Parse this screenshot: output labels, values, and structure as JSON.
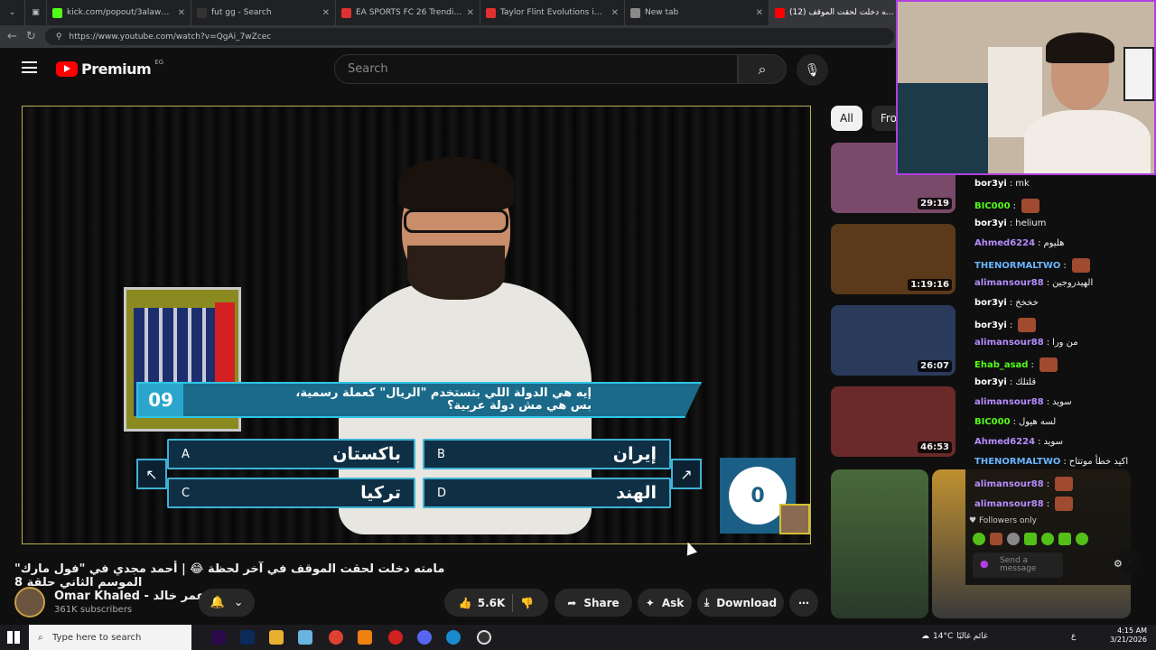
{
  "browser": {
    "tabs": [
      {
        "title": "kick.com/popout/3alawyhd/",
        "color": "#53fc18",
        "active": false
      },
      {
        "title": "fut gg - Search",
        "color": "#333333",
        "active": false
      },
      {
        "title": "EA SPORTS FC 26 Trending Evolu",
        "color": "#e03030",
        "active": false
      },
      {
        "title": "Taylor Flint Evolutions in EA FC 2",
        "color": "#e03030",
        "active": false
      },
      {
        "title": "New tab",
        "color": "#888888",
        "active": false
      },
      {
        "title": "(12) مامته دخلت لحقت الموقف",
        "color": "#ff0000",
        "active": true
      }
    ],
    "url": "https://www.youtube.com/watch?v=QgAi_7wZcec"
  },
  "header": {
    "logo_text": "Premium",
    "region": "EG",
    "search_placeholder": "Search"
  },
  "player": {
    "question_number": "09",
    "question": "إيه هي الدولة اللي بتستخدم \"الريال\" كعملة رسمية، بس هي مش دولة عربية؟",
    "answers": [
      {
        "letter": "A",
        "text": "باكستان"
      },
      {
        "letter": "B",
        "text": "إيران"
      },
      {
        "letter": "C",
        "text": "تركيا"
      },
      {
        "letter": "D",
        "text": "الهند"
      }
    ],
    "score": "0"
  },
  "video": {
    "title": "مامته دخلت لحقت الموقف في آخر لحظة 😂 | أحمد مجدي في \"فول مارك\" الموسم الثاني حلقة 8",
    "channel": "Omar Khaled - عمر خالد",
    "subscribers": "361K subscribers",
    "likes": "5.6K",
    "share_label": "Share",
    "ask_label": "Ask",
    "download_label": "Download"
  },
  "sidebar": {
    "chips": [
      "All",
      "From"
    ],
    "videos": [
      {
        "duration": "29:19",
        "color": "#7a4a6a"
      },
      {
        "duration": "1:19:16",
        "color": "#5a3a1a"
      },
      {
        "duration": "26:07",
        "color": "#2a3a5a"
      },
      {
        "duration": "46:53",
        "color": "#6a2a2a"
      }
    ]
  },
  "chat": {
    "messages": [
      {
        "user": "bor3yi",
        "text": "mk",
        "color": "#ffffff"
      },
      {
        "user": "BIC000",
        "text": "",
        "color": "#53fc18",
        "emote": true
      },
      {
        "user": "bor3yi",
        "text": "helium",
        "color": "#ffffff"
      },
      {
        "user": "Ahmed6224",
        "text": "هليوم",
        "color": "#b68cff"
      },
      {
        "user": "THENORMALTWO",
        "text": "",
        "color": "#6ab4ff",
        "emote": true
      },
      {
        "user": "alimansour88",
        "text": "الهيدروجين",
        "color": "#b68cff"
      },
      {
        "user": "bor3yi",
        "text": "خخخخ",
        "color": "#ffffff"
      },
      {
        "user": "bor3yi",
        "text": "",
        "color": "#ffffff",
        "emote": true
      },
      {
        "user": "alimansour88",
        "text": "من ورا",
        "color": "#b68cff"
      },
      {
        "user": "Ehab_asad",
        "text": "",
        "color": "#53fc18",
        "emote": true
      },
      {
        "user": "bor3yi",
        "text": "قلتلك",
        "color": "#ffffff"
      },
      {
        "user": "alimansour88",
        "text": "سويد",
        "color": "#b68cff"
      },
      {
        "user": "BIC000",
        "text": "لسه هيول",
        "color": "#53fc18"
      },
      {
        "user": "Ahmed6224",
        "text": "سويد",
        "color": "#b68cff"
      },
      {
        "user": "THENORMALTWO",
        "text": "اكيد خطأ موتتاح",
        "color": "#6ab4ff"
      },
      {
        "user": "alimansour88",
        "text": "",
        "color": "#b68cff",
        "emote": true
      },
      {
        "user": "alimansour88",
        "text": "",
        "color": "#b68cff",
        "emote": true
      }
    ],
    "followers_only": "Followers only",
    "send_placeholder": "Send a message"
  },
  "taskbar": {
    "search_placeholder": "Type here to search",
    "weather": "14°C",
    "weather_text": "غائم غالبًا",
    "time": "4:15 AM",
    "date": "3/21/2026",
    "lang": "ع"
  }
}
